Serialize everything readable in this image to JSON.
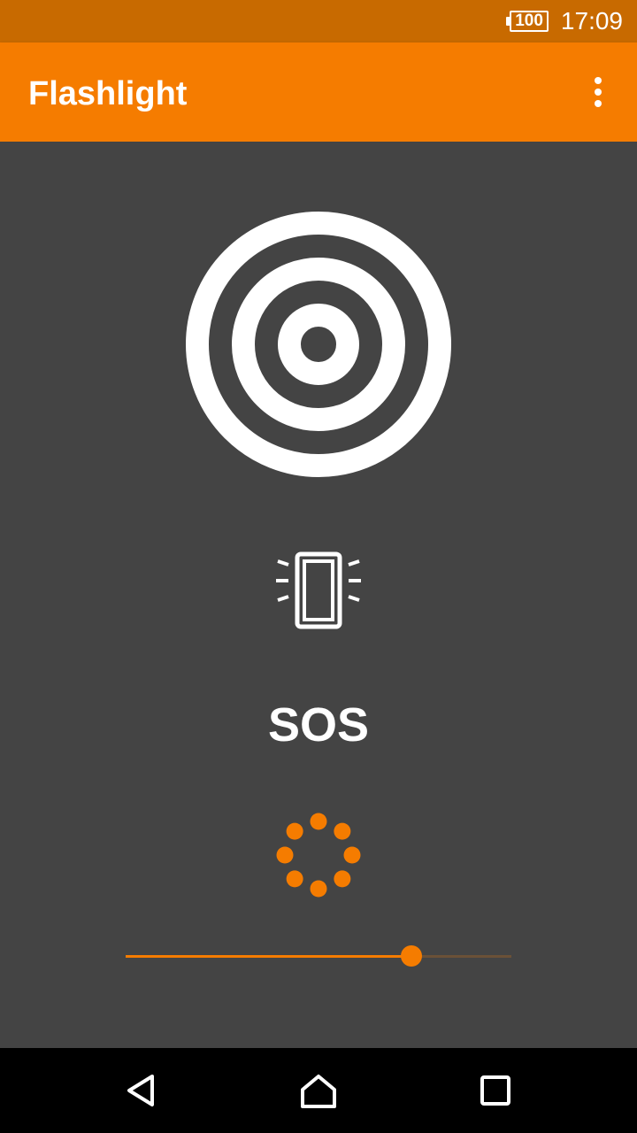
{
  "status_bar": {
    "battery_level": "100",
    "time": "17:09",
    "background_color": "#c86a00"
  },
  "app_bar": {
    "title": "Flashlight",
    "menu_icon": "more-vert-icon",
    "background_color": "#f57c00"
  },
  "main": {
    "power_icon": "concentric-circles-icon",
    "strobe_icon": "phone-flashing-icon",
    "sos_label": "SOS",
    "loading_icon": "dots-spinner-icon",
    "brightness_slider": {
      "value": 0.74
    },
    "background_color": "#444444",
    "accent_color": "#f57c00"
  },
  "nav_bar": {
    "back_icon": "back-triangle-icon",
    "home_icon": "home-icon",
    "recents_icon": "recents-square-icon"
  }
}
